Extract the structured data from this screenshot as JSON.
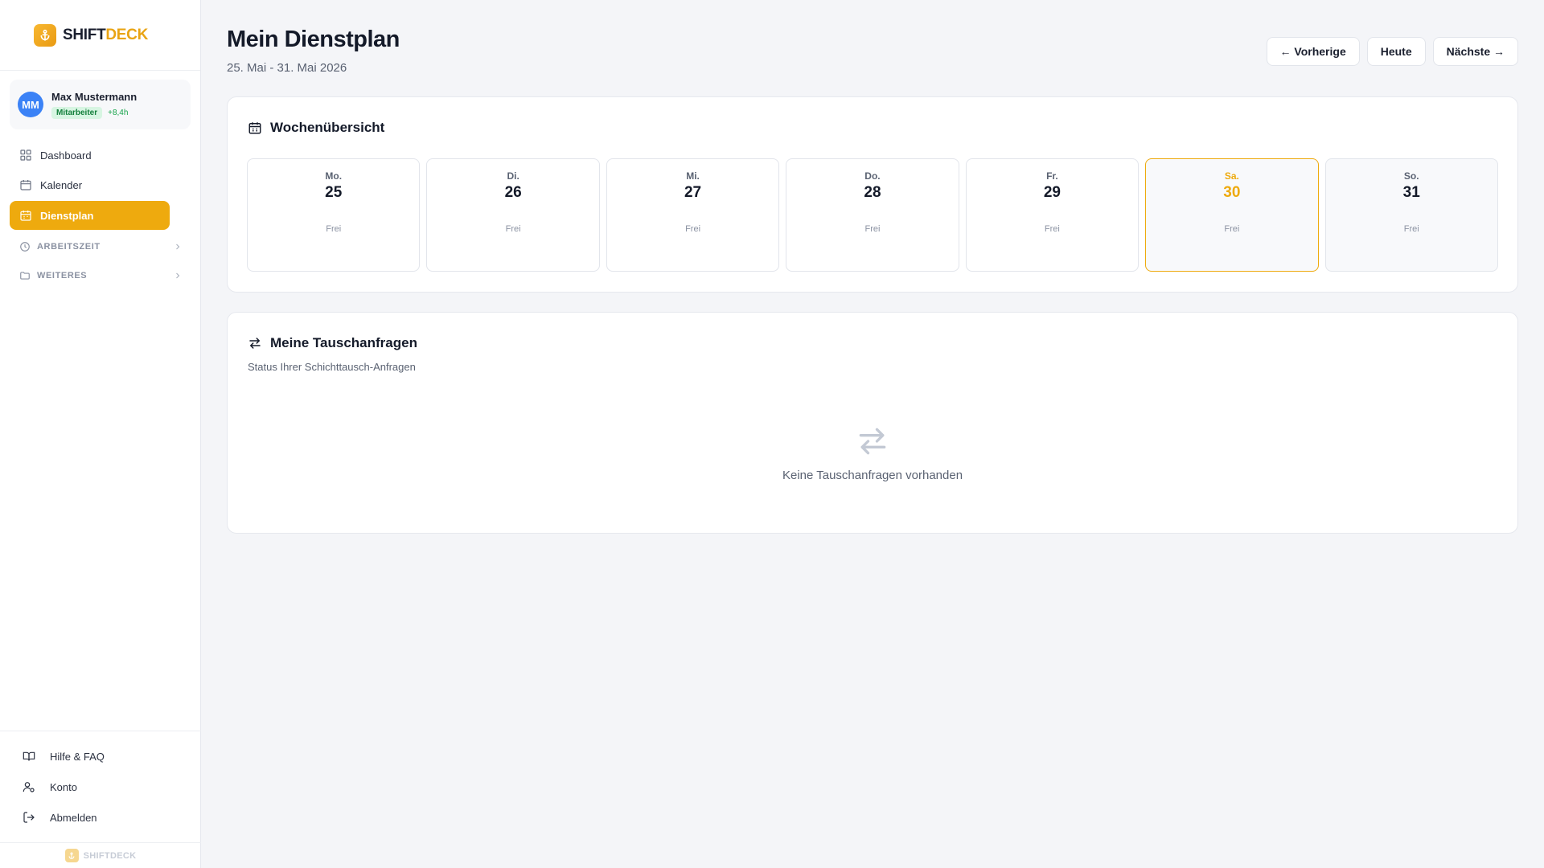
{
  "brand": {
    "name_a": "SHIFT",
    "name_b": "DECK"
  },
  "user": {
    "initials": "MM",
    "name": "Max Mustermann",
    "role": "Mitarbeiter",
    "hours": "+8,4h"
  },
  "nav": {
    "items": [
      {
        "label": "Dashboard",
        "icon": "dashboard-icon"
      },
      {
        "label": "Kalender",
        "icon": "calendar-icon"
      },
      {
        "label": "Dienstplan",
        "icon": "calendar-grid-icon",
        "active": true
      }
    ],
    "sections": [
      {
        "label": "ARBEITSZEIT",
        "icon": "clock-icon"
      },
      {
        "label": "WEITERES",
        "icon": "folder-icon"
      }
    ]
  },
  "bottom_nav": [
    {
      "label": "Hilfe & FAQ",
      "icon": "book-icon"
    },
    {
      "label": "Konto",
      "icon": "user-settings-icon"
    },
    {
      "label": "Abmelden",
      "icon": "logout-icon"
    }
  ],
  "footer": {
    "brand": "SHIFTDECK"
  },
  "page": {
    "title": "Mein Dienstplan",
    "date_range": "25. Mai - 31. Mai 2026",
    "buttons": {
      "prev": "← Vorherige",
      "today": "Heute",
      "next": "Nächste →"
    }
  },
  "week": {
    "title": "Wochenübersicht",
    "days": [
      {
        "name": "Mo.",
        "date": "25",
        "status": "Frei"
      },
      {
        "name": "Di.",
        "date": "26",
        "status": "Frei"
      },
      {
        "name": "Mi.",
        "date": "27",
        "status": "Frei"
      },
      {
        "name": "Do.",
        "date": "28",
        "status": "Frei"
      },
      {
        "name": "Fr.",
        "date": "29",
        "status": "Frei"
      },
      {
        "name": "Sa.",
        "date": "30",
        "status": "Frei",
        "today": true
      },
      {
        "name": "So.",
        "date": "31",
        "status": "Frei"
      }
    ]
  },
  "swap": {
    "title": "Meine Tauschanfragen",
    "description": "Status Ihrer Schichttausch-Anfragen",
    "empty_text": "Keine Tauschanfragen vorhanden"
  },
  "colors": {
    "accent": "#eeaa0e",
    "avatar": "#3b82f6",
    "badge_bg": "#d7f5e2",
    "badge_text": "#15803d"
  }
}
